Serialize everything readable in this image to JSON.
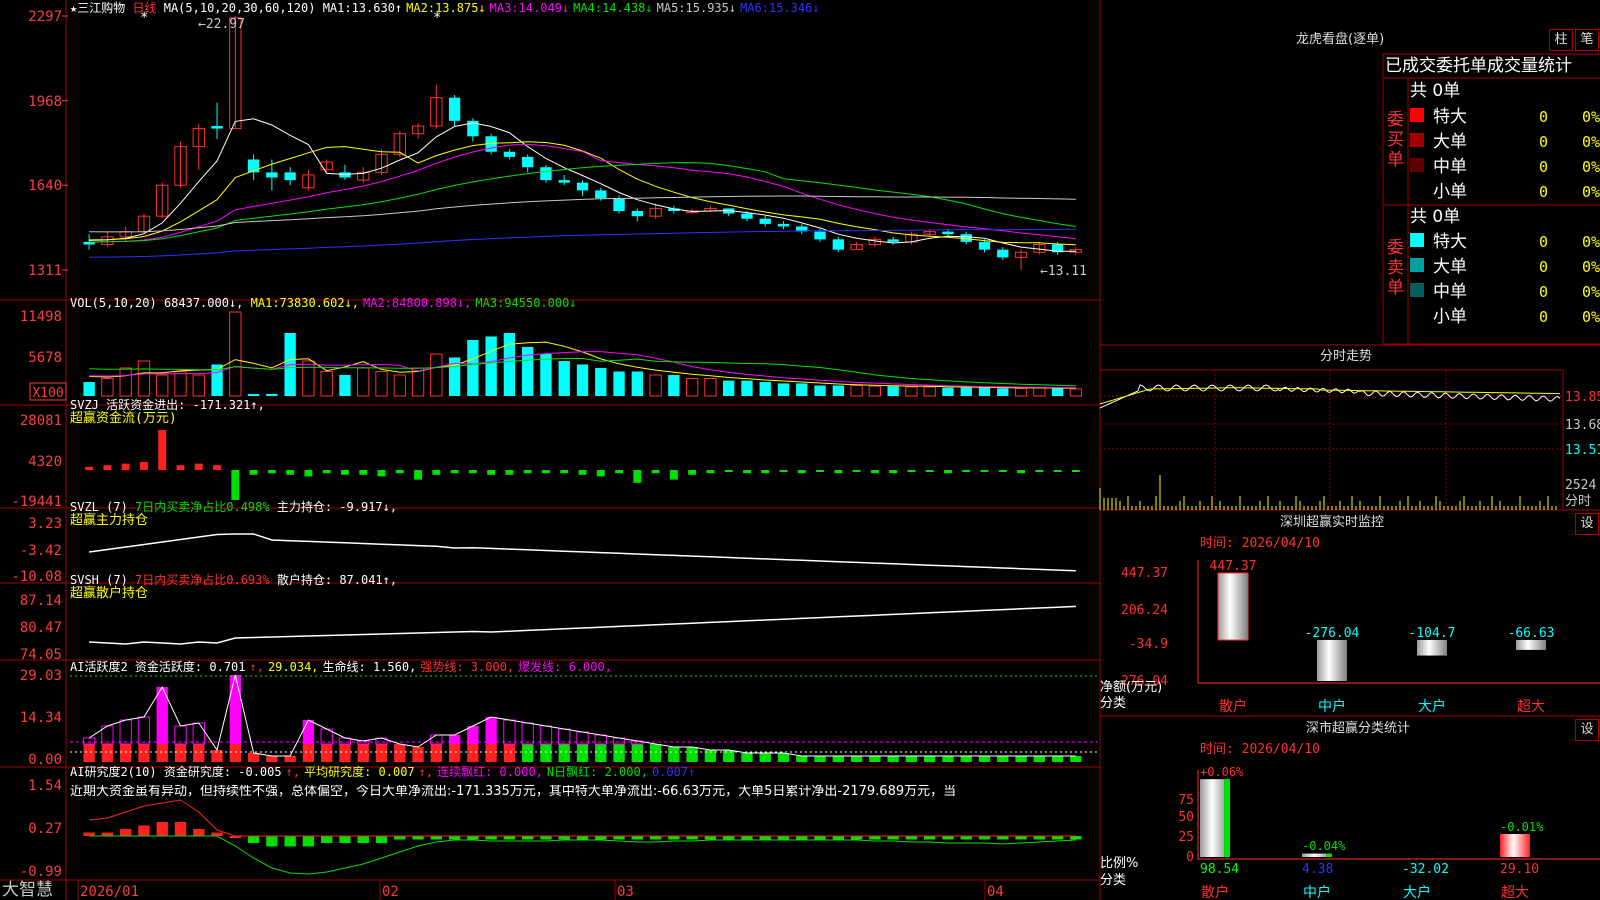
{
  "app_name": "大智慧",
  "stock": {
    "name": "三江购物",
    "period": "日线"
  },
  "price_panel": {
    "ma_header": "MA(5,10,20,30,60,120)",
    "ma_values": [
      {
        "label": "MA1:",
        "value": "13.630",
        "arrow": "↑",
        "color": "#ffffff"
      },
      {
        "label": "MA2:",
        "value": "13.875",
        "arrow": "↓",
        "color": "#ffff00"
      },
      {
        "label": "MA3:",
        "value": "14.049",
        "arrow": "↓",
        "color": "#ff00ff"
      },
      {
        "label": "MA4:",
        "value": "14.438",
        "arrow": "↓",
        "color": "#00e000"
      },
      {
        "label": "MA5:",
        "value": "15.935",
        "arrow": "↓",
        "color": "#c8c8c8"
      },
      {
        "label": "MA6:",
        "value": "15.346",
        "arrow": "↓",
        "color": "#3030ff"
      }
    ],
    "high_label": "←22.97",
    "low_label": "←13.11",
    "y_ticks": [
      "2297",
      "1968",
      "1640",
      "1311"
    ]
  },
  "vol_panel": {
    "header": "VOL(5,10,20)",
    "value": "68437.000↓,",
    "mas": [
      {
        "label": "MA1:",
        "value": "73830.602↓,",
        "color": "#ffff00"
      },
      {
        "label": "MA2:",
        "value": "84800.898↓,",
        "color": "#ff00ff"
      },
      {
        "label": "MA3:",
        "value": "94550.000↓",
        "color": "#00e000"
      }
    ],
    "y_ticks": [
      "11498",
      "5678"
    ],
    "unit": "X100"
  },
  "svzj_panel": {
    "header": "SVZJ",
    "label": "活跃资金进出:",
    "value": "-171.321↑,",
    "subtitle": "超赢资金流(万元)",
    "y_ticks": [
      "28081",
      "4320",
      "-19441"
    ]
  },
  "svzl_panel": {
    "header": "SVZL (7)",
    "label1": "7日内买卖净占比0.498%",
    "label2": "主力持仓:",
    "value": "-9.917↓,",
    "subtitle": "超赢主力持仓",
    "y_ticks": [
      "3.23",
      "-3.42",
      "-10.08"
    ]
  },
  "svsh_panel": {
    "header": "SVSH (7)",
    "label1": "7日内买卖净占比0.693%",
    "label2": "散户持仓:",
    "value": "87.041↑,",
    "subtitle": "超赢散户持仓",
    "y_ticks": [
      "87.14",
      "80.47",
      "74.05"
    ]
  },
  "ai_active_panel": {
    "header": "AI活跃度2",
    "items": [
      {
        "text": "资金活跃度: 0.701",
        "color": "#ffffff"
      },
      {
        "text": "↑,",
        "color": "#ff3030"
      },
      {
        "text": "29.034,",
        "color": "#ffff00"
      },
      {
        "text": "生命线: 1.560,",
        "color": "#ffffff"
      },
      {
        "text": "强势线: 3.000,",
        "color": "#ff3030"
      },
      {
        "text": "爆发线: 6.000,",
        "color": "#ff00ff"
      }
    ],
    "y_ticks": [
      "29.03",
      "14.34",
      "0.00"
    ]
  },
  "ai_research_panel": {
    "header": "AI研究度2(10)",
    "items": [
      {
        "text": "资金研究度: -0.005",
        "color": "#ffffff"
      },
      {
        "text": "↑,",
        "color": "#ff3030"
      },
      {
        "text": "平均研究度: 0.007",
        "color": "#ffff00"
      },
      {
        "text": "↑,",
        "color": "#ff3030"
      },
      {
        "text": "连续飘红: 0.000,",
        "color": "#ff00ff"
      },
      {
        "text": "N日飘红: 2.000,",
        "color": "#00e000"
      },
      {
        "text": "0.007↑",
        "color": "#3030ff"
      }
    ],
    "comment": "近期大资金虽有异动，但持续性不强，总体偏空，今日大单净流出:-171.335万元，其中特大单净流出:-66.63万元，大单5日累计净出-2179.689万元，当",
    "y_ticks": [
      "1.54",
      "0.27",
      "-0.99"
    ]
  },
  "x_axis": [
    "2026/01",
    "02",
    "03",
    "04"
  ],
  "right": {
    "dragon": {
      "title": "龙虎看盘(逐单)",
      "btn_bar": "柱",
      "btn_pen": "笔",
      "table_title": "已成交委托单成交量统计",
      "buy_label": "委买单",
      "sell_label": "委卖单",
      "buy_total": "共 0单",
      "sell_total": "共 0单",
      "buy_rows": [
        {
          "name": "特大",
          "count": "0",
          "pct": "0%",
          "color": "#ff0000"
        },
        {
          "name": "大单",
          "count": "0",
          "pct": "0%",
          "color": "#a00000"
        },
        {
          "name": "中单",
          "count": "0",
          "pct": "0%",
          "color": "#600000"
        },
        {
          "name": "小单",
          "count": "0",
          "pct": "0%",
          "color": ""
        }
      ],
      "sell_rows": [
        {
          "name": "特大",
          "count": "0",
          "pct": "0%",
          "color": "#00ffff"
        },
        {
          "name": "大单",
          "count": "0",
          "pct": "0%",
          "color": "#00a0a0"
        },
        {
          "name": "中单",
          "count": "0",
          "pct": "0%",
          "color": "#006060"
        },
        {
          "name": "小单",
          "count": "0",
          "pct": "0%",
          "color": ""
        }
      ]
    },
    "intraday": {
      "title": "分时走势",
      "price_ticks": [
        "13.85",
        "13.68",
        "13.51"
      ],
      "vol_label": "2524",
      "unit": "分时"
    },
    "monitor": {
      "title": "深圳超赢实时监控",
      "settings": "设",
      "time": "时间: 2026/04/10",
      "y_ticks": [
        "447.37",
        "206.24",
        "-34.9",
        "-276.04"
      ],
      "side_label1": "净额(万元)",
      "side_label2": "分类",
      "categories": [
        "散户",
        "中户",
        "大户",
        "超大"
      ],
      "values": [
        447.37,
        -276.04,
        -104.7,
        -66.63
      ],
      "value_labels": [
        "447.37",
        "-276.04",
        "-104.7",
        "-66.63"
      ]
    },
    "classify": {
      "title": "深市超赢分类统计",
      "settings": "设",
      "time": "时间: 2026/04/10",
      "y_ticks": [
        "75",
        "50",
        "25",
        "0"
      ],
      "side_label1": "比例%",
      "side_label2": "分类",
      "categories": [
        "散户",
        "中户",
        "大户",
        "超大"
      ],
      "values": [
        98.54,
        4.38,
        -32.02,
        29.1
      ],
      "value_labels": [
        "98.54",
        "4.38",
        "-32.02",
        "29.10"
      ],
      "change_labels": [
        "+0.06%",
        "-0.04%",
        "",
        "-0.01%"
      ]
    }
  },
  "chart_data": [
    {
      "type": "candlestick",
      "title": "三江购物 日线",
      "y_ticks": [
        22.97,
        19.68,
        16.4,
        13.11
      ],
      "candles": [
        [
          14.2,
          14.1,
          14.5,
          13.9
        ],
        [
          14.1,
          14.4,
          14.6,
          14.0
        ],
        [
          14.4,
          14.6,
          14.8,
          14.2
        ],
        [
          14.6,
          15.2,
          15.3,
          14.5
        ],
        [
          15.2,
          16.4,
          16.5,
          15.1
        ],
        [
          16.4,
          17.9,
          18.1,
          16.3
        ],
        [
          17.9,
          18.6,
          18.8,
          17.0
        ],
        [
          18.7,
          18.6,
          19.6,
          18.2
        ],
        [
          18.6,
          22.9,
          22.97,
          18.6
        ],
        [
          17.4,
          16.9,
          17.6,
          16.6
        ],
        [
          16.9,
          16.7,
          17.4,
          16.2
        ],
        [
          16.9,
          16.6,
          17.1,
          16.4
        ],
        [
          16.3,
          16.8,
          17.0,
          16.2
        ],
        [
          17.0,
          17.3,
          17.4,
          16.9
        ],
        [
          16.9,
          16.7,
          17.2,
          16.6
        ],
        [
          16.6,
          16.9,
          17.1,
          16.5
        ],
        [
          16.9,
          17.6,
          17.8,
          16.8
        ],
        [
          17.6,
          18.4,
          18.5,
          17.5
        ],
        [
          18.4,
          18.7,
          18.8,
          18.2
        ],
        [
          18.7,
          19.8,
          20.3,
          18.6
        ],
        [
          19.8,
          18.9,
          19.9,
          18.7
        ],
        [
          18.9,
          18.3,
          19.0,
          18.1
        ],
        [
          18.3,
          17.7,
          18.4,
          17.6
        ],
        [
          17.7,
          17.5,
          17.8,
          17.4
        ],
        [
          17.5,
          17.1,
          17.6,
          16.9
        ],
        [
          17.1,
          16.6,
          17.2,
          16.5
        ],
        [
          16.6,
          16.5,
          16.8,
          16.4
        ],
        [
          16.5,
          16.2,
          16.6,
          16.0
        ],
        [
          16.2,
          15.9,
          16.3,
          15.8
        ],
        [
          15.9,
          15.4,
          16.0,
          15.3
        ],
        [
          15.4,
          15.2,
          15.5,
          15.0
        ],
        [
          15.2,
          15.5,
          15.7,
          15.1
        ],
        [
          15.5,
          15.4,
          15.6,
          15.3
        ],
        [
          15.4,
          15.4,
          15.5,
          15.3
        ],
        [
          15.4,
          15.5,
          15.6,
          15.4
        ],
        [
          15.5,
          15.3,
          15.5,
          15.2
        ],
        [
          15.3,
          15.1,
          15.4,
          15.0
        ],
        [
          15.1,
          14.9,
          15.2,
          14.8
        ],
        [
          14.9,
          14.8,
          15.0,
          14.7
        ],
        [
          14.8,
          14.6,
          14.9,
          14.5
        ],
        [
          14.6,
          14.3,
          14.7,
          14.2
        ],
        [
          14.3,
          13.9,
          14.4,
          13.8
        ],
        [
          13.9,
          14.1,
          14.2,
          13.9
        ],
        [
          14.1,
          14.3,
          14.4,
          14.0
        ],
        [
          14.3,
          14.2,
          14.4,
          14.1
        ],
        [
          14.2,
          14.5,
          14.6,
          14.1
        ],
        [
          14.5,
          14.6,
          14.7,
          14.4
        ],
        [
          14.6,
          14.5,
          14.7,
          14.4
        ],
        [
          14.5,
          14.2,
          14.6,
          14.1
        ],
        [
          14.2,
          13.9,
          14.3,
          13.8
        ],
        [
          13.9,
          13.6,
          14.0,
          13.5
        ],
        [
          13.6,
          13.8,
          13.9,
          13.11
        ],
        [
          13.8,
          14.1,
          14.2,
          13.7
        ],
        [
          14.1,
          13.8,
          14.2,
          13.7
        ],
        [
          13.8,
          13.9,
          14.0,
          13.7
        ]
      ]
    },
    {
      "type": "bar",
      "title": "VOL(5,10,20)",
      "y_ticks": [
        11498,
        5678
      ],
      "values": [
        20,
        25,
        40,
        50,
        30,
        35,
        30,
        45,
        120,
        3,
        3,
        90,
        50,
        35,
        30,
        40,
        35,
        30,
        40,
        60,
        55,
        80,
        85,
        90,
        70,
        60,
        50,
        45,
        40,
        35,
        35,
        30,
        30,
        25,
        25,
        22,
        22,
        20,
        18,
        18,
        15,
        15,
        15,
        14,
        14,
        13,
        13,
        12,
        12,
        12,
        11,
        11,
        12,
        11,
        10
      ]
    },
    {
      "type": "bar",
      "title": "超赢资金流(万元)",
      "y_ticks": [
        28081,
        4320,
        -19441
      ],
      "values": [
        2,
        3,
        4,
        5,
        28081,
        3,
        4,
        3,
        -19441,
        -3,
        -2,
        -3,
        -4,
        -2,
        -3,
        -3,
        -4,
        -2,
        -6,
        -3,
        -2,
        -2,
        -3,
        -3,
        -2,
        -2,
        -2,
        -3,
        -4,
        -2,
        -8,
        -2,
        -6,
        -3,
        -2,
        -1,
        -2,
        -2,
        -1,
        -2,
        -1,
        -2,
        -1,
        -2,
        -2,
        -1,
        -1,
        -2,
        -1,
        -1,
        -1,
        -2,
        -1,
        -1,
        -1
      ]
    }
  ]
}
